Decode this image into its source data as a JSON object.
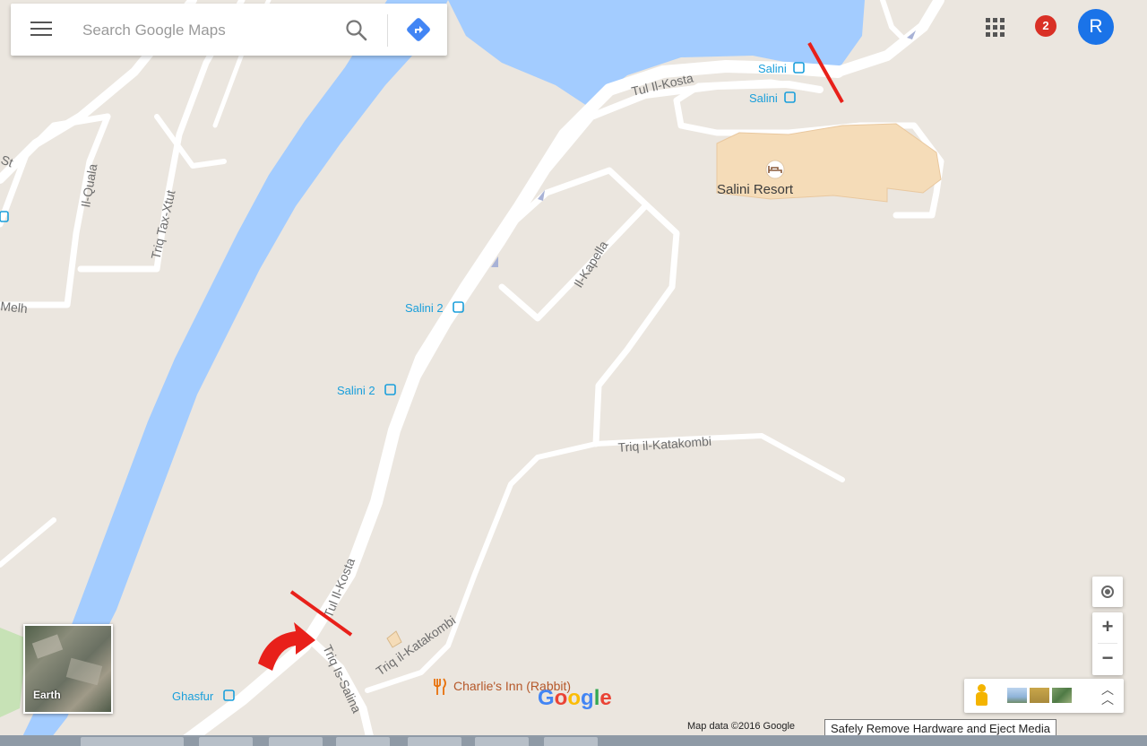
{
  "search": {
    "placeholder": "Search Google Maps"
  },
  "account": {
    "notifications": "2",
    "avatar_initial": "R"
  },
  "streets": {
    "tul_il_kosta_top": "Tul Il-Kosta",
    "tul_il_kosta_bottom": "Tul Il-Kosta",
    "il_quala": "Il-Quala",
    "triq_tax_xtut": "Triq Tax-Xtut",
    "il_kapella": "Il-Kapella",
    "triq_il_katakombi_mid": "Triq il-Katakombi",
    "triq_il_katakombi_low": "Triq il-Katakombi",
    "triq_is_salina": "Triq Is-Salina",
    "melh": "Melh",
    "st": "St"
  },
  "bus_stops": {
    "salini_1": "Salini",
    "salini_2": "Salini",
    "salini2_a": "Salini 2",
    "salini2_b": "Salini 2",
    "ghasfur": "Ghasfur"
  },
  "places": {
    "salini_resort": "Salini Resort",
    "charlies_inn": "Charlie's Inn (Rabbit)"
  },
  "earth_label": "Earth",
  "zoom": {
    "in": "+",
    "out": "−"
  },
  "google_logo": {
    "letters": [
      "G",
      "o",
      "o",
      "g",
      "l",
      "e"
    ],
    "colors": [
      "#4285F4",
      "#EA4335",
      "#FBBC05",
      "#4285F4",
      "#34A853",
      "#EA4335"
    ]
  },
  "footer": {
    "map_data": "Map data ©2016 Google"
  },
  "tooltip": "Safely Remove Hardware and Eject Media",
  "colors": {
    "land": "#ebe6df",
    "water": "#a3ccff",
    "road": "#ffffff",
    "transit": "#1a9fdb",
    "annotation": "#e8201a"
  }
}
